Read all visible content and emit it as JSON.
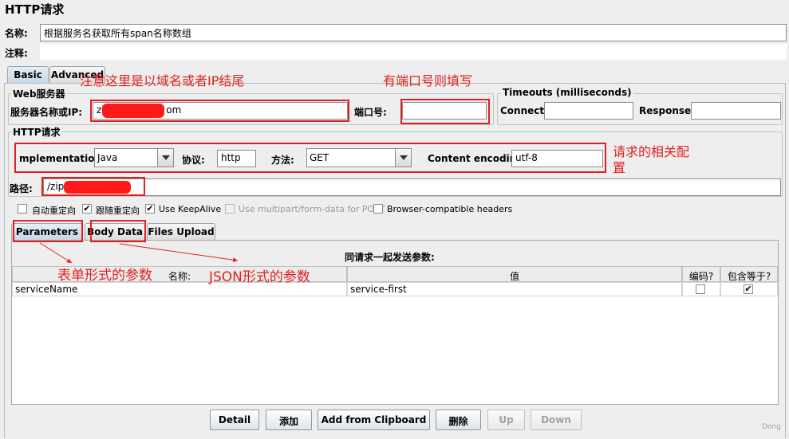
{
  "panel_title": "HTTP请求",
  "name": {
    "label": "名称:",
    "value": "根据服务名获取所有span名称数组"
  },
  "comment": {
    "label": "注释:"
  },
  "top_tabs": [
    "Basic",
    "Advanced"
  ],
  "web_server": {
    "group_title": "Web服务器",
    "server_label": "服务器名称或IP:",
    "server_value_prefix": "zip",
    "server_value_suffix": "om",
    "port_label": "端口号:",
    "port_value": ""
  },
  "timeouts": {
    "group_title": "Timeouts (milliseconds)",
    "connect_label": "Connect:",
    "response_label": "Response:"
  },
  "http_request": {
    "group_title": "HTTP请求",
    "implementation_label": "mplementation:",
    "implementation_value": "Java",
    "protocol_label": "协议:",
    "protocol_value": "http",
    "method_label": "方法:",
    "method_value": "GET",
    "encoding_label": "Content encoding:",
    "encoding_value": "utf-8",
    "path_label": "路径:",
    "path_value_prefix": "/zip"
  },
  "options": [
    {
      "label": "自动重定向",
      "checked": false,
      "disabled": false
    },
    {
      "label": "跟随重定向",
      "checked": true,
      "disabled": false
    },
    {
      "label": "Use KeepAlive",
      "checked": true,
      "disabled": false
    },
    {
      "label": "Use multipart/form-data for POST",
      "checked": false,
      "disabled": true
    },
    {
      "label": "Browser-compatible headers",
      "checked": false,
      "disabled": false
    }
  ],
  "param_tabs": [
    "Parameters",
    "Body Data",
    "Files Upload"
  ],
  "params": {
    "caption": "同请求一起发送参数:",
    "columns": {
      "name": "名称:",
      "value": "值",
      "encode": "编码?",
      "include_equals": "包含等于?"
    },
    "rows": [
      {
        "name": "serviceName",
        "value": "service-first",
        "encode": false,
        "include_equals": true
      }
    ]
  },
  "buttons": {
    "detail": "Detail",
    "add": "添加",
    "clipboard": "Add from Clipboard",
    "delete": "删除",
    "up": "Up",
    "down": "Down"
  },
  "annotations": {
    "domain_note": "注意这里是以域名或者IP结尾",
    "port_note": "有端口号则填写",
    "config_note_line1": "请求的相关配",
    "config_note_line2": "置",
    "form_note": "表单形式的参数",
    "json_note": "JSON形式的参数"
  },
  "watermark": "Dong",
  "colors": {
    "annotation": "#e02020",
    "background": "#eeeeee"
  }
}
